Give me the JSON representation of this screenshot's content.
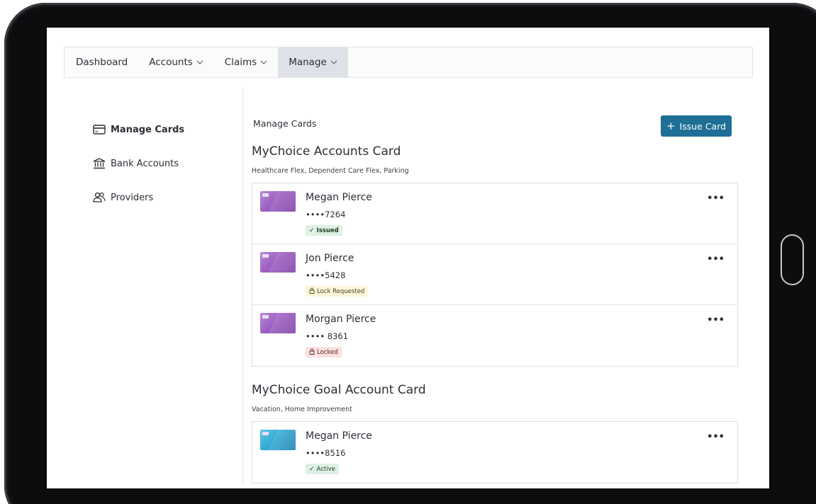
{
  "nav": {
    "items": [
      {
        "label": "Dashboard",
        "has_menu": false,
        "active": false
      },
      {
        "label": "Accounts",
        "has_menu": true,
        "active": false
      },
      {
        "label": "Claims",
        "has_menu": true,
        "active": false
      },
      {
        "label": "Manage",
        "has_menu": true,
        "active": true
      }
    ]
  },
  "sidebar": {
    "items": [
      {
        "label": "Manage Cards",
        "icon": "credit-card-icon",
        "selected": true
      },
      {
        "label": "Bank Accounts",
        "icon": "bank-icon",
        "selected": false
      },
      {
        "label": "Providers",
        "icon": "people-icon",
        "selected": false
      }
    ]
  },
  "main": {
    "title": "Manage Cards",
    "issue_button": {
      "icon": "+",
      "label": "Issue Card"
    },
    "sections": [
      {
        "title": "MyChoice Accounts Card",
        "subtitle": "Healthcare Flex, Dependent Care Flex, Parking",
        "cards": [
          {
            "name": "Megan Pierce",
            "number": "••••7264",
            "status": "Issued",
            "status_icon": "✓",
            "color": "purple"
          },
          {
            "name": "Jon Pierce",
            "number": "••••5428",
            "status": "Lock Requested",
            "status_icon": "lock",
            "color": "purple"
          },
          {
            "name": "Morgan Pierce",
            "number": "•••• 8361",
            "status": "Locked",
            "status_icon": "lock",
            "color": "purple"
          }
        ]
      },
      {
        "title": "MyChoice Goal Account Card",
        "subtitle": "Vacation, Home Improvement",
        "cards": [
          {
            "name": "Megan Pierce",
            "number": "••••8516",
            "status": "Active",
            "status_icon": "✓",
            "color": "blue"
          }
        ]
      }
    ],
    "more_icon": "•••"
  },
  "colors": {
    "primary": "#1e6f96",
    "nav_active_bg": "#dfe1e8",
    "badge_green": "#dff0e4",
    "badge_yellow": "#fbf5d9",
    "badge_red": "#fbe1e1"
  }
}
